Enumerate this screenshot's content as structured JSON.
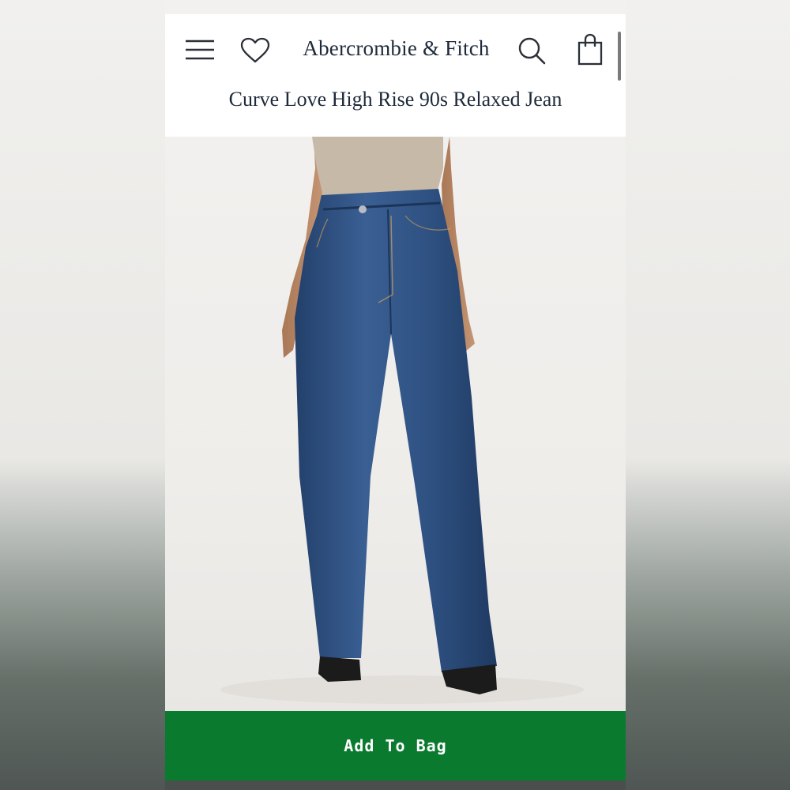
{
  "header": {
    "brand": "Abercrombie & Fitch",
    "icons": {
      "menu": "menu-icon",
      "wishlist": "heart-icon",
      "search": "search-icon",
      "bag": "shopping-bag-icon"
    }
  },
  "product": {
    "title": "Curve Love High Rise 90s Relaxed Jean",
    "image": "model wearing medium-wash high rise relaxed jeans"
  },
  "actions": {
    "add_to_bag_label": "Add To Bag"
  },
  "colors": {
    "brand_navy": "#1e2a3a",
    "cta_green": "#0a7a2f",
    "denim": "#2f5283"
  }
}
